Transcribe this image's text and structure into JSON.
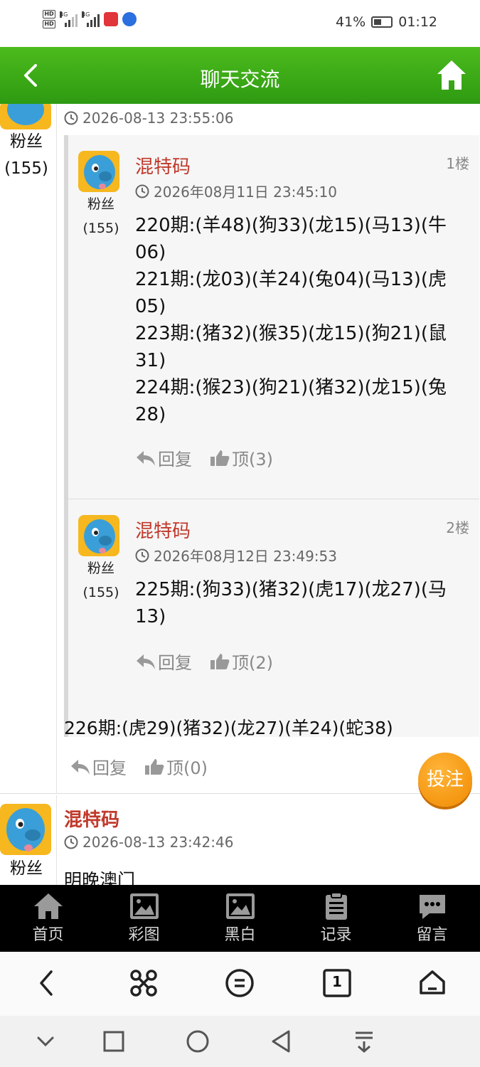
{
  "status_bar": {
    "hd1": "HD",
    "hd2": "HD",
    "net1": "4G",
    "net2": "4G",
    "battery": "41%",
    "time": "01:12"
  },
  "header": {
    "title": "聊天交流"
  },
  "post1": {
    "fan_label": "粉丝",
    "fan_count": "(155)",
    "time": "2026-08-13 23:55:06",
    "floors": [
      {
        "name": "混特码",
        "floor": "1楼",
        "time": "2026年08月11日 23:45:10",
        "fan_label": "粉丝",
        "fan_count": "(155)",
        "lines": [
          "220期:(羊48)(狗33)(龙15)(马13)(牛",
          "06)",
          "221期:(龙03)(羊24)(兔04)(马13)(虎",
          "05)",
          "223期:(猪32)(猴35)(龙15)(狗21)(鼠",
          "31)",
          "224期:(猴23)(狗21)(猪32)(龙15)(兔",
          "28)"
        ],
        "reply": "回复",
        "like": "顶(3)"
      },
      {
        "name": "混特码",
        "floor": "2楼",
        "time": "2026年08月12日 23:49:53",
        "fan_label": "粉丝",
        "fan_count": "(155)",
        "lines": [
          "225期:(狗33)(猪32)(虎17)(龙27)(马",
          "13)"
        ],
        "reply": "回复",
        "like": "顶(2)"
      }
    ],
    "text": "226期:(虎29)(猪32)(龙27)(羊24)(蛇38)",
    "reply": "回复",
    "like": "顶(0)"
  },
  "bet_button": "投注",
  "post2": {
    "name": "混特码",
    "time": "2026-08-13 23:42:46",
    "fan_label": "粉丝",
    "text": "明晚澳门"
  },
  "bottom_nav": [
    {
      "label": "首页",
      "icon": "home-icon"
    },
    {
      "label": "彩图",
      "icon": "image-icon"
    },
    {
      "label": "黑白",
      "icon": "image-icon"
    },
    {
      "label": "记录",
      "icon": "clipboard-icon"
    },
    {
      "label": "留言",
      "icon": "chat-icon"
    }
  ],
  "browser_bar": [
    "back-icon",
    "menu-icon",
    "list-icon",
    "tabs-icon",
    "home-icon"
  ],
  "browser_tab_count": "1",
  "colors": {
    "header_green": "#3aa816",
    "name_red": "#c0392b",
    "bet_orange": "#f39c12"
  }
}
